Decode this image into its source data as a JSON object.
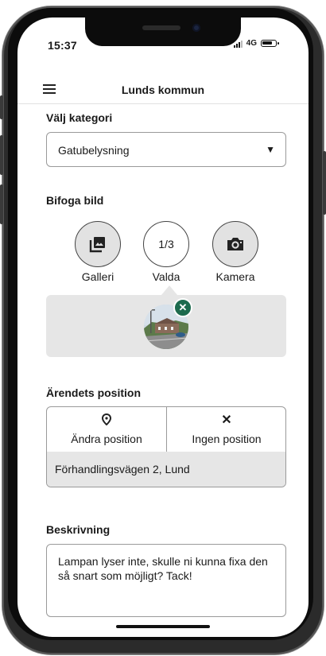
{
  "status_bar": {
    "time": "15:37",
    "network": "4G"
  },
  "app_bar": {
    "title": "Lunds kommun",
    "menu_icon": "hamburger-menu-icon"
  },
  "category": {
    "heading": "Välj kategori",
    "selected": "Gatubelysning",
    "caret": "▼"
  },
  "attach": {
    "heading": "Bifoga bild",
    "gallery_label": "Galleri",
    "selected_count": "1/3",
    "selected_label": "Valda",
    "camera_label": "Kamera",
    "remove_glyph": "✕"
  },
  "position": {
    "heading": "Ärendets position",
    "change_label": "Ändra position",
    "none_label": "Ingen position",
    "none_glyph": "✕",
    "address": "Förhandlingsvägen 2, Lund"
  },
  "description": {
    "heading": "Beskrivning",
    "text": "Lampan lyser inte, skulle ni kunna fixa den så snart som möjligt? Tack!"
  },
  "colors": {
    "remove_badge": "#1d6b4e",
    "panel_gray": "#e6e6e6"
  }
}
